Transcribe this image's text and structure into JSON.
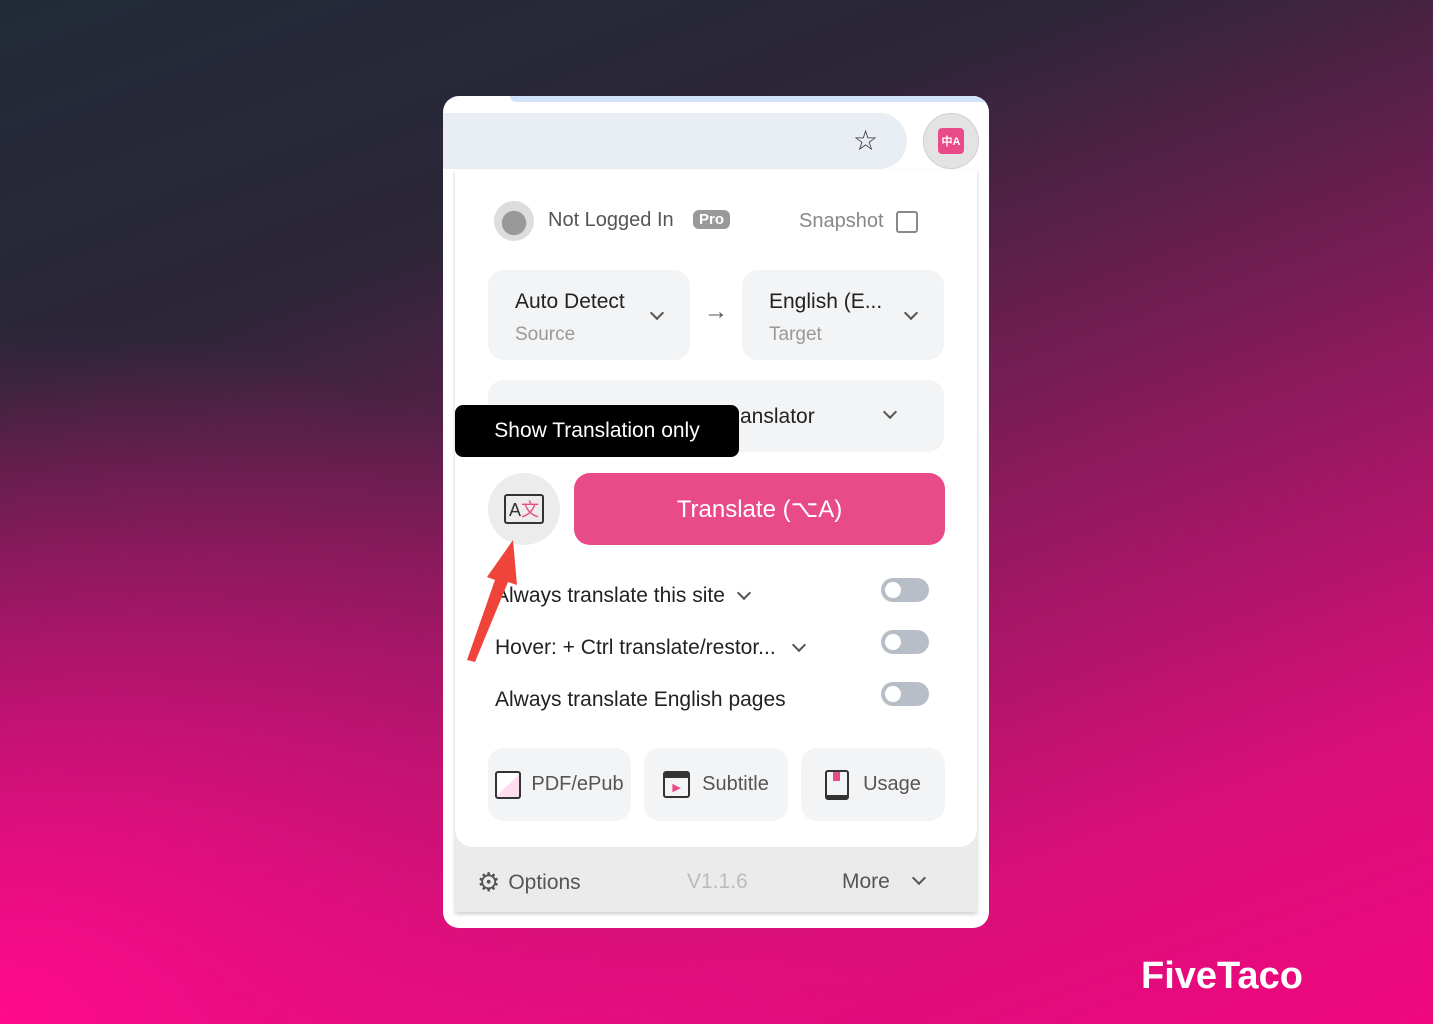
{
  "browser": {
    "bookmark_icon": "star-icon",
    "extension_icon": "translate-icon",
    "extension_glyph": "中A"
  },
  "header": {
    "user": "Not Logged In",
    "badge": "Pro",
    "snapshot": "Snapshot"
  },
  "languages": {
    "source_value": "Auto Detect",
    "source_label": "Source",
    "target_value": "English (E...",
    "target_label": "Target"
  },
  "service": {
    "value_visible": "anslator"
  },
  "tooltip": "Show Translation only",
  "translate_button": "Translate (⌥A)",
  "settings": [
    {
      "label": "Always translate this site",
      "has_dropdown": true,
      "enabled": false
    },
    {
      "label": "Hover:  + Ctrl translate/restor...",
      "has_dropdown": true,
      "enabled": false
    },
    {
      "label": "Always translate English pages",
      "has_dropdown": false,
      "enabled": false
    }
  ],
  "tools": [
    {
      "label": "PDF/ePub"
    },
    {
      "label": "Subtitle"
    },
    {
      "label": "Usage"
    }
  ],
  "footer": {
    "options": "Options",
    "version": "V1.1.6",
    "more": "More"
  },
  "watermark": "FiveTaco",
  "colors": {
    "accent": "#e94b89",
    "arrow": "#f0443a"
  }
}
